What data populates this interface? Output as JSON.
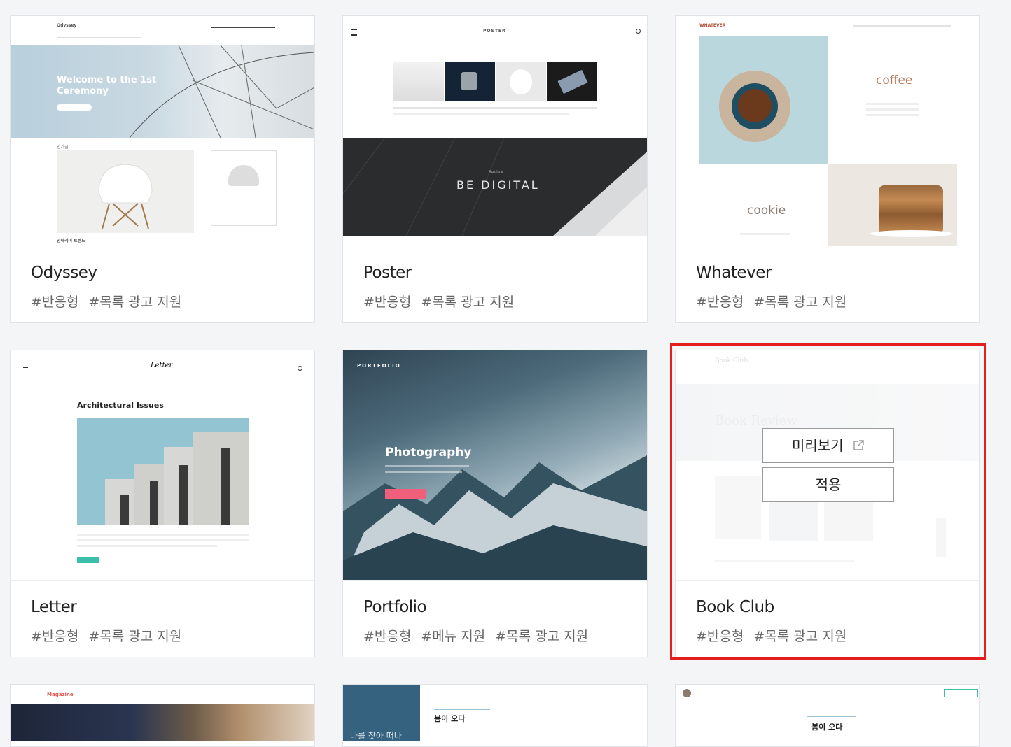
{
  "themes": [
    {
      "name": "Odyssey",
      "tags": [
        "#반응형",
        "#목록 광고 지원"
      ]
    },
    {
      "name": "Poster",
      "tags": [
        "#반응형",
        "#목록 광고 지원"
      ]
    },
    {
      "name": "Whatever",
      "tags": [
        "#반응형",
        "#목록 광고 지원"
      ]
    },
    {
      "name": "Letter",
      "tags": [
        "#반응형",
        "#목록 광고 지원"
      ]
    },
    {
      "name": "Portfolio",
      "tags": [
        "#반응형",
        "#메뉴 지원",
        "#목록 광고 지원"
      ]
    },
    {
      "name": "Book Club",
      "tags": [
        "#반응형",
        "#목록 광고 지원"
      ]
    }
  ],
  "thumb_text": {
    "odyssey_brand": "Odyssey",
    "odyssey_heading": "Welcome to the 1st Ceremony",
    "odyssey_section": "인테리어 트렌드",
    "poster_brand": "POSTER",
    "poster_banner": "BE DIGITAL",
    "poster_banner_small": "Review",
    "whatever_brand": "WHATEVER",
    "whatever_coffee": "coffee",
    "whatever_cookie": "cookie",
    "letter_brand": "Letter",
    "letter_heading": "Architectural Issues",
    "portfolio_brand": "PORTFOLIO",
    "portfolio_heading": "Photography",
    "bookclub_brand": "Book Club",
    "bookclub_hero": "Book Review",
    "magazine_brand": "Magazine",
    "row3_mid_title": "봄이 오다",
    "row3_mid_side": "나를 찾아 떠나",
    "row3_right_title": "봄이 오다"
  },
  "overlay": {
    "preview_label": "미리보기",
    "apply_label": "적용"
  },
  "colors": {
    "highlight": "#e41d1d",
    "magazine_red": "#e5584f",
    "portfolio_pink": "#f0607a",
    "letter_teal": "#3cbfaa"
  }
}
